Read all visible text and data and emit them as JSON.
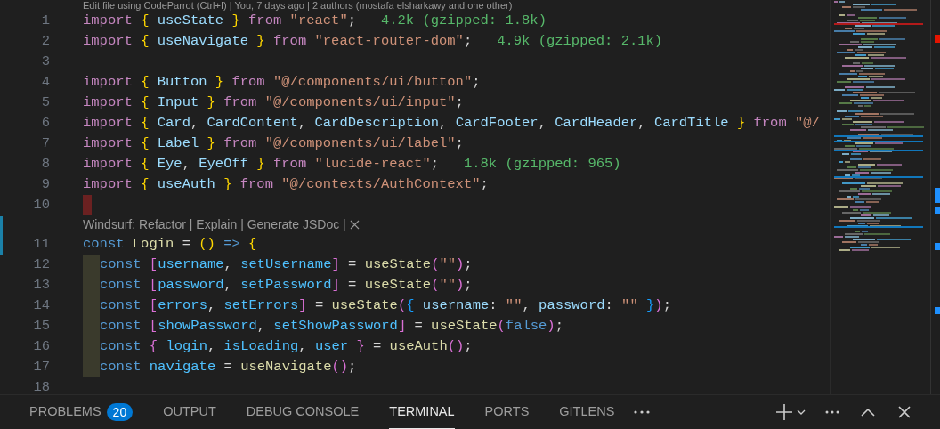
{
  "codelens_top": "Edit file using CodeParrot (Ctrl+I) | You, 7 days ago | 2 authors (mostafa elsharkawy and one other)",
  "lines": [
    {
      "kind": "code",
      "number": "1",
      "tokens": [
        {
          "kind": "keyword",
          "text": "import "
        },
        {
          "kind": "bracket1",
          "text": "{ "
        },
        {
          "kind": "variable",
          "text": "useState"
        },
        {
          "kind": "bracket1",
          "text": " }"
        },
        {
          "kind": "keyword",
          "text": " from "
        },
        {
          "kind": "string",
          "text": "\"react\""
        },
        {
          "kind": "plain",
          "text": ";  "
        },
        {
          "kind": "size",
          "text": " 4.2k (gzipped: 1.8k)"
        }
      ]
    },
    {
      "kind": "code",
      "number": "2",
      "tokens": [
        {
          "kind": "keyword",
          "text": "import "
        },
        {
          "kind": "bracket1",
          "text": "{ "
        },
        {
          "kind": "variable",
          "text": "useNavigate"
        },
        {
          "kind": "bracket1",
          "text": " }"
        },
        {
          "kind": "keyword",
          "text": " from "
        },
        {
          "kind": "string",
          "text": "\"react-router-dom\""
        },
        {
          "kind": "plain",
          "text": ";  "
        },
        {
          "kind": "size",
          "text": " 4.9k (gzipped: 2.1k)"
        }
      ]
    },
    {
      "kind": "code",
      "number": "3"
    },
    {
      "kind": "code",
      "number": "4",
      "tokens": [
        {
          "kind": "keyword",
          "text": "import "
        },
        {
          "kind": "bracket1",
          "text": "{ "
        },
        {
          "kind": "variable",
          "text": "Button"
        },
        {
          "kind": "bracket1",
          "text": " }"
        },
        {
          "kind": "keyword",
          "text": " from "
        },
        {
          "kind": "string",
          "text": "\"@/components/ui/button\""
        },
        {
          "kind": "plain",
          "text": ";"
        }
      ]
    },
    {
      "kind": "code",
      "number": "5",
      "tokens": [
        {
          "kind": "keyword",
          "text": "import "
        },
        {
          "kind": "bracket1",
          "text": "{ "
        },
        {
          "kind": "variable",
          "text": "Input"
        },
        {
          "kind": "bracket1",
          "text": " }"
        },
        {
          "kind": "keyword",
          "text": " from "
        },
        {
          "kind": "string",
          "text": "\"@/components/ui/input\""
        },
        {
          "kind": "plain",
          "text": ";"
        }
      ]
    },
    {
      "kind": "code",
      "number": "6",
      "tokens": [
        {
          "kind": "keyword",
          "text": "import "
        },
        {
          "kind": "bracket1",
          "text": "{ "
        },
        {
          "kind": "variable",
          "text": "Card"
        },
        {
          "kind": "plain",
          "text": ", "
        },
        {
          "kind": "variable",
          "text": "CardContent"
        },
        {
          "kind": "plain",
          "text": ", "
        },
        {
          "kind": "variable",
          "text": "CardDescription"
        },
        {
          "kind": "plain",
          "text": ", "
        },
        {
          "kind": "variable",
          "text": "CardFooter"
        },
        {
          "kind": "plain",
          "text": ", "
        },
        {
          "kind": "variable",
          "text": "CardHeader"
        },
        {
          "kind": "plain",
          "text": ", "
        },
        {
          "kind": "variable",
          "text": "CardTitle"
        },
        {
          "kind": "bracket1",
          "text": " }"
        },
        {
          "kind": "keyword",
          "text": " from "
        },
        {
          "kind": "string",
          "text": "\"@/"
        }
      ]
    },
    {
      "kind": "code",
      "number": "7",
      "tokens": [
        {
          "kind": "keyword",
          "text": "import "
        },
        {
          "kind": "bracket1",
          "text": "{ "
        },
        {
          "kind": "variable",
          "text": "Label"
        },
        {
          "kind": "bracket1",
          "text": " }"
        },
        {
          "kind": "keyword",
          "text": " from "
        },
        {
          "kind": "string",
          "text": "\"@/components/ui/label\""
        },
        {
          "kind": "plain",
          "text": ";"
        }
      ]
    },
    {
      "kind": "code",
      "number": "8",
      "tokens": [
        {
          "kind": "keyword",
          "text": "import "
        },
        {
          "kind": "bracket1",
          "text": "{ "
        },
        {
          "kind": "variable",
          "text": "Eye"
        },
        {
          "kind": "plain",
          "text": ", "
        },
        {
          "kind": "variable",
          "text": "EyeOff"
        },
        {
          "kind": "bracket1",
          "text": " }"
        },
        {
          "kind": "keyword",
          "text": " from "
        },
        {
          "kind": "string",
          "text": "\"lucide-react\""
        },
        {
          "kind": "plain",
          "text": ";  "
        },
        {
          "kind": "size",
          "text": " 1.8k (gzipped: 965)"
        }
      ]
    },
    {
      "kind": "code",
      "number": "9",
      "tokens": [
        {
          "kind": "keyword",
          "text": "import "
        },
        {
          "kind": "bracket1",
          "text": "{ "
        },
        {
          "kind": "variable",
          "text": "useAuth"
        },
        {
          "kind": "bracket1",
          "text": " }"
        },
        {
          "kind": "keyword",
          "text": " from "
        },
        {
          "kind": "string",
          "text": "\"@/contexts/AuthContext\""
        },
        {
          "kind": "plain",
          "text": ";"
        }
      ]
    },
    {
      "kind": "code",
      "number": "10",
      "tokens": [
        {
          "kind": "marker"
        }
      ]
    },
    {
      "kind": "codelens",
      "text": "Windsurf: Refactor | Explain | Generate JSDoc |"
    },
    {
      "kind": "code",
      "number": "11",
      "modified": true,
      "tokens": [
        {
          "kind": "storage",
          "text": "const "
        },
        {
          "kind": "function",
          "text": "Login"
        },
        {
          "kind": "plain",
          "text": " = "
        },
        {
          "kind": "bracket1",
          "text": "()"
        },
        {
          "kind": "storage",
          "text": " =>"
        },
        {
          "kind": "bracket1",
          "text": " {"
        }
      ]
    },
    {
      "kind": "code",
      "number": "12",
      "tokens": [
        {
          "kind": "indent"
        },
        {
          "kind": "storage",
          "text": "const "
        },
        {
          "kind": "bracket2",
          "text": "["
        },
        {
          "kind": "constant",
          "text": "username"
        },
        {
          "kind": "plain",
          "text": ", "
        },
        {
          "kind": "constant",
          "text": "setUsername"
        },
        {
          "kind": "bracket2",
          "text": "]"
        },
        {
          "kind": "plain",
          "text": " = "
        },
        {
          "kind": "function",
          "text": "useState"
        },
        {
          "kind": "bracket2",
          "text": "("
        },
        {
          "kind": "string",
          "text": "\"\""
        },
        {
          "kind": "bracket2",
          "text": ")"
        },
        {
          "kind": "plain",
          "text": ";"
        }
      ]
    },
    {
      "kind": "code",
      "number": "13",
      "tokens": [
        {
          "kind": "indent"
        },
        {
          "kind": "storage",
          "text": "const "
        },
        {
          "kind": "bracket2",
          "text": "["
        },
        {
          "kind": "constant",
          "text": "password"
        },
        {
          "kind": "plain",
          "text": ", "
        },
        {
          "kind": "constant",
          "text": "setPassword"
        },
        {
          "kind": "bracket2",
          "text": "]"
        },
        {
          "kind": "plain",
          "text": " = "
        },
        {
          "kind": "function",
          "text": "useState"
        },
        {
          "kind": "bracket2",
          "text": "("
        },
        {
          "kind": "string",
          "text": "\"\""
        },
        {
          "kind": "bracket2",
          "text": ")"
        },
        {
          "kind": "plain",
          "text": ";"
        }
      ]
    },
    {
      "kind": "code",
      "number": "14",
      "tokens": [
        {
          "kind": "indent"
        },
        {
          "kind": "storage",
          "text": "const "
        },
        {
          "kind": "bracket2",
          "text": "["
        },
        {
          "kind": "constant",
          "text": "errors"
        },
        {
          "kind": "plain",
          "text": ", "
        },
        {
          "kind": "constant",
          "text": "setErrors"
        },
        {
          "kind": "bracket2",
          "text": "]"
        },
        {
          "kind": "plain",
          "text": " = "
        },
        {
          "kind": "function",
          "text": "useState"
        },
        {
          "kind": "bracket2",
          "text": "("
        },
        {
          "kind": "bracket3",
          "text": "{ "
        },
        {
          "kind": "variable",
          "text": "username"
        },
        {
          "kind": "plain",
          "text": ": "
        },
        {
          "kind": "string",
          "text": "\"\""
        },
        {
          "kind": "plain",
          "text": ", "
        },
        {
          "kind": "variable",
          "text": "password"
        },
        {
          "kind": "plain",
          "text": ": "
        },
        {
          "kind": "string",
          "text": "\"\""
        },
        {
          "kind": "bracket3",
          "text": " }"
        },
        {
          "kind": "bracket2",
          "text": ")"
        },
        {
          "kind": "plain",
          "text": ";"
        }
      ]
    },
    {
      "kind": "code",
      "number": "15",
      "tokens": [
        {
          "kind": "indent"
        },
        {
          "kind": "storage",
          "text": "const "
        },
        {
          "kind": "bracket2",
          "text": "["
        },
        {
          "kind": "constant",
          "text": "showPassword"
        },
        {
          "kind": "plain",
          "text": ", "
        },
        {
          "kind": "constant",
          "text": "setShowPassword"
        },
        {
          "kind": "bracket2",
          "text": "]"
        },
        {
          "kind": "plain",
          "text": " = "
        },
        {
          "kind": "function",
          "text": "useState"
        },
        {
          "kind": "bracket2",
          "text": "("
        },
        {
          "kind": "storage",
          "text": "false"
        },
        {
          "kind": "bracket2",
          "text": ")"
        },
        {
          "kind": "plain",
          "text": ";"
        }
      ]
    },
    {
      "kind": "code",
      "number": "16",
      "tokens": [
        {
          "kind": "indent"
        },
        {
          "kind": "storage",
          "text": "const "
        },
        {
          "kind": "bracket2",
          "text": "{ "
        },
        {
          "kind": "constant",
          "text": "login"
        },
        {
          "kind": "plain",
          "text": ", "
        },
        {
          "kind": "constant",
          "text": "isLoading"
        },
        {
          "kind": "plain",
          "text": ", "
        },
        {
          "kind": "constant",
          "text": "user"
        },
        {
          "kind": "bracket2",
          "text": " }"
        },
        {
          "kind": "plain",
          "text": " = "
        },
        {
          "kind": "function",
          "text": "useAuth"
        },
        {
          "kind": "bracket2",
          "text": "()"
        },
        {
          "kind": "plain",
          "text": ";"
        }
      ]
    },
    {
      "kind": "code",
      "number": "17",
      "tokens": [
        {
          "kind": "indent"
        },
        {
          "kind": "storage",
          "text": "const "
        },
        {
          "kind": "constant",
          "text": "navigate"
        },
        {
          "kind": "plain",
          "text": " = "
        },
        {
          "kind": "function",
          "text": "useNavigate"
        },
        {
          "kind": "bracket2",
          "text": "()"
        },
        {
          "kind": "plain",
          "text": ";"
        }
      ]
    },
    {
      "kind": "code",
      "number": "18"
    }
  ],
  "panel": {
    "tabs": [
      {
        "label": "PROBLEMS",
        "badge": "20",
        "selected": false
      },
      {
        "label": "OUTPUT",
        "selected": false
      },
      {
        "label": "DEBUG CONSOLE",
        "selected": false
      },
      {
        "label": "TERMINAL",
        "selected": true
      },
      {
        "label": "PORTS",
        "selected": false
      },
      {
        "label": "GITLENS",
        "selected": false
      }
    ]
  }
}
